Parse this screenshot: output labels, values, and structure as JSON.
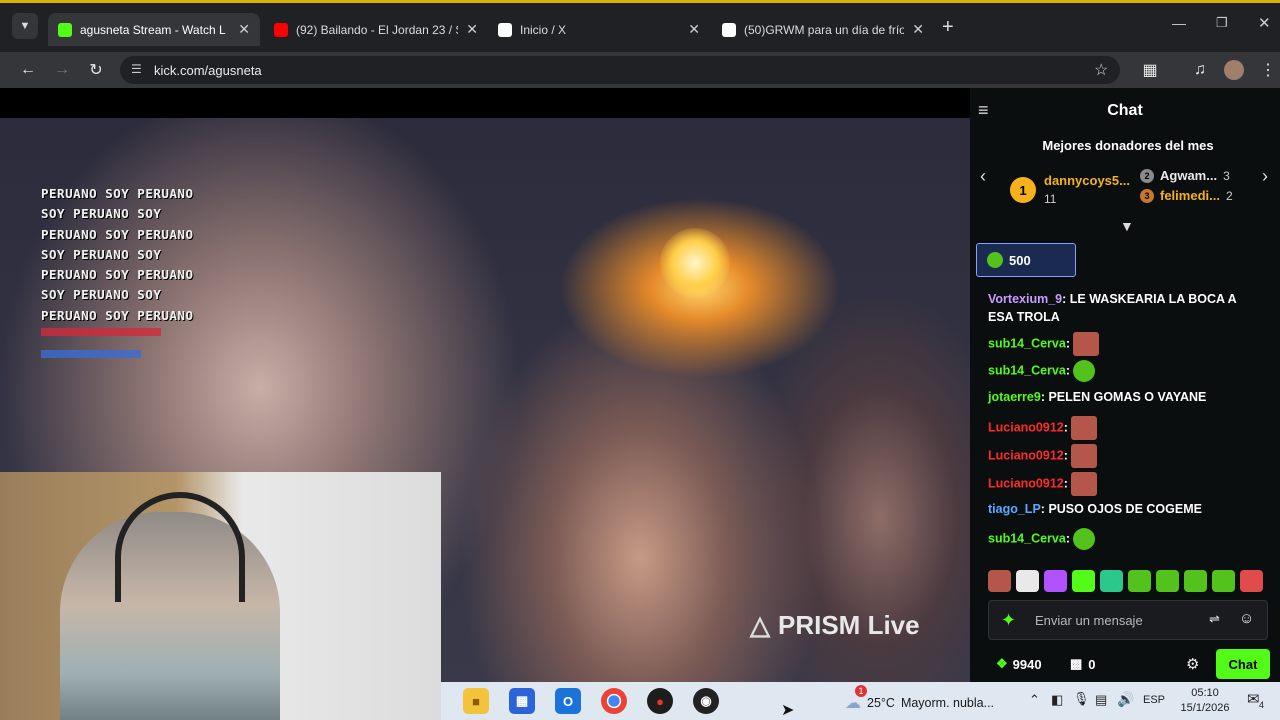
{
  "browser": {
    "tabs": [
      {
        "title": "agusneta Stream - Watch L",
        "favicon": "kick-icon",
        "favicon_color": "#53fc18",
        "active": true
      },
      {
        "title": "(92) Bailando - El Jordan 23 / St",
        "favicon": "youtube-icon",
        "favicon_color": "#ff0000",
        "active": false
      },
      {
        "title": "Inicio / X",
        "favicon": "x-icon",
        "favicon_color": "#ffffff",
        "active": false
      },
      {
        "title": "(50)GRWM para un día de frío",
        "favicon": "tiktok-icon",
        "favicon_color": "#ffffff",
        "active": false
      }
    ],
    "new_tab_symbol": "+",
    "url": "kick.com/agusneta"
  },
  "video": {
    "overlay_lines": [
      "PERUANO SOY PERUANO",
      "SOY PERUANO SOY",
      "PERUANO SOY PERUANO",
      "SOY PERUANO SOY",
      "PERUANO SOY PERUANO",
      "SOY PERUANO SOY",
      "PERUANO SOY PERUANO"
    ],
    "watermark": "PRISM Live"
  },
  "chat": {
    "title": "Chat",
    "donors_title": "Mejores donadores del mes",
    "donors": [
      {
        "rank": "1",
        "name": "dannycoys5...",
        "amount": "11"
      },
      {
        "rank": "2",
        "name": "Agwam...",
        "amount": "3"
      },
      {
        "rank": "3",
        "name": "felimedi...",
        "amount": "2"
      }
    ],
    "pinned_amount": "500",
    "messages": [
      {
        "user": "Vortexium_9",
        "color": "#c99cff",
        "text": "LE WASKEARIA LA BOCA A",
        "text2": "ESA TROLA",
        "emote": ""
      },
      {
        "user": "sub14_Cerva",
        "color": "#53fc18",
        "text": "",
        "emote": "red"
      },
      {
        "user": "sub14_Cerva",
        "color": "#53fc18",
        "text": "",
        "emote": "green"
      },
      {
        "user": "jotaerre9",
        "color": "#53fc18",
        "text": "PELEN GOMAS O VAYANE",
        "emote": ""
      },
      {
        "user": "Luciano0912",
        "color": "#ff2b2b",
        "text": "",
        "emote": "red"
      },
      {
        "user": "Luciano0912",
        "color": "#ff2b2b",
        "text": "",
        "emote": "red"
      },
      {
        "user": "Luciano0912",
        "color": "#ff2b2b",
        "text": "",
        "emote": "red"
      },
      {
        "user": "tiago_LP",
        "color": "#5aa8ff",
        "text": "PUSO OJOS DE COGEME",
        "emote": ""
      },
      {
        "user": "sub14_Cerva",
        "color": "#53fc18",
        "text": "",
        "emote": "green"
      }
    ],
    "input_placeholder": "Enviar un mensaje",
    "points": "9940",
    "gifts": "0",
    "send_label": "Chat"
  },
  "taskbar": {
    "weather_temp": "25°C",
    "weather_text": "Mayorm. nubla...",
    "language": "ESP",
    "time": "05:10",
    "date": "15/1/2026",
    "notification_count": "4",
    "weather_badge": "1"
  }
}
